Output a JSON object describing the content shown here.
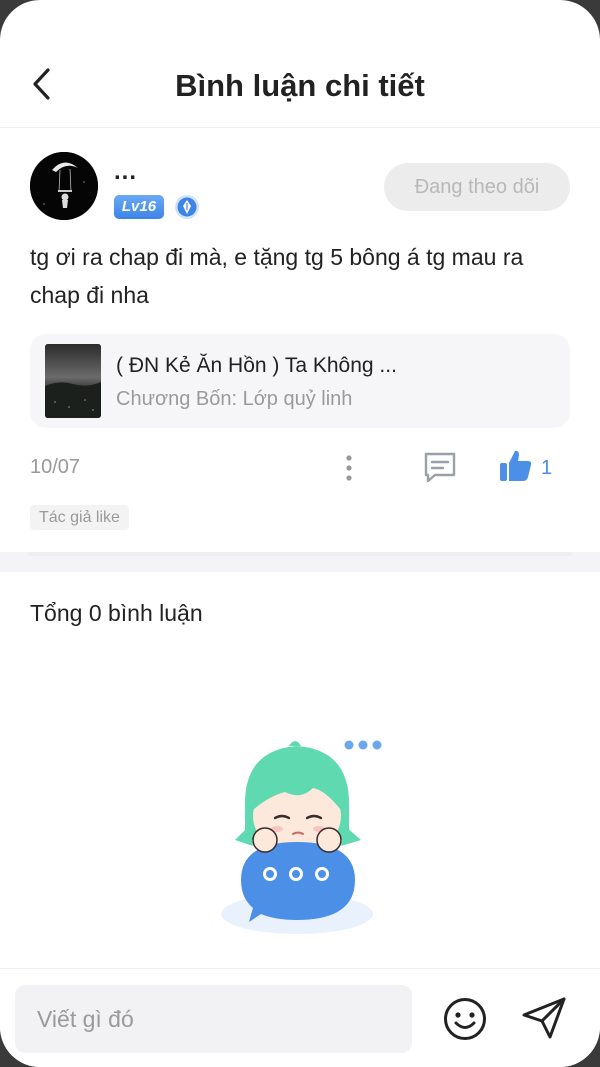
{
  "header": {
    "title": "Bình luận chi tiết",
    "back_icon": "chevron-left-icon"
  },
  "post": {
    "username": "...",
    "level": "Lv16",
    "follow_label": "Đang theo dõi",
    "text": "tg ơi ra chap đi mà, e tặng tg 5 bông á tg mau ra chap đi nha",
    "story": {
      "title": "( ĐN Kẻ Ăn Hồn ) Ta Không ...",
      "chapter": "Chương Bốn: Lớp quỷ linh"
    },
    "date": "10/07",
    "like_count": "1",
    "author_like_tag": "Tác giả like"
  },
  "comments": {
    "total_label": "Tổng 0 bình luận"
  },
  "input": {
    "placeholder": "Viết gì đó"
  },
  "colors": {
    "accent": "#4b8fe6",
    "follow_bg": "#ececec",
    "muted_text": "#999999"
  }
}
